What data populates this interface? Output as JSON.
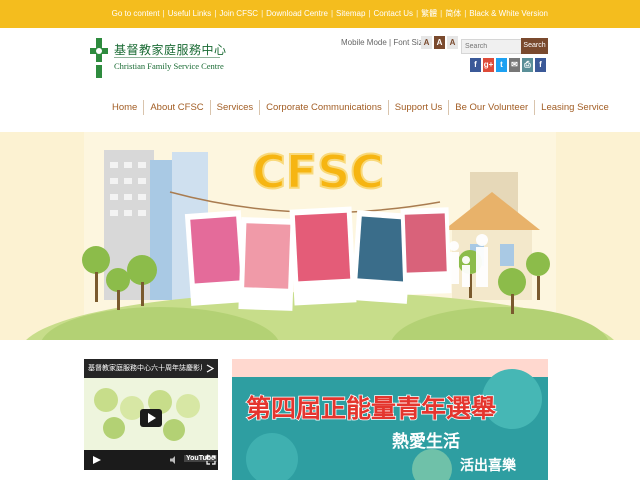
{
  "top_links": {
    "go_to_content": "Go to content",
    "useful_links": "Useful Links",
    "join": "Join CFSC",
    "download": "Download Centre",
    "sitemap": "Sitemap",
    "contact": "Contact Us",
    "trad_chinese": "繁體",
    "simp_chinese": "简体",
    "bw_version": "Black & White Version"
  },
  "logo": {
    "name_cn": "基督教家庭服務中心",
    "name_en": "Christian Family Service Centre"
  },
  "toolbar": {
    "mobile_mode": "Mobile Mode | Font Size :",
    "font_sizes": [
      "A",
      "A",
      "A"
    ],
    "search_placeholder": "Search",
    "search_button": "Search"
  },
  "social": {
    "icons": [
      "facebook-icon",
      "google-plus-icon",
      "twitter-icon",
      "email-icon",
      "print-icon",
      "facebook-icon"
    ],
    "labels": [
      "f",
      "g+",
      "t",
      "✉",
      "⎙",
      "f"
    ],
    "colors": [
      "#3b5998",
      "#dd4b39",
      "#1da1f2",
      "#777777",
      "#5a8f98",
      "#3b5998"
    ]
  },
  "nav": {
    "items": [
      "Home",
      "About CFSC",
      "Services",
      "Corporate Communications",
      "Support Us",
      "Be Our Volunteer",
      "Leasing Service"
    ]
  },
  "banner": {
    "headline": "CFSC"
  },
  "video": {
    "title": "基督教家庭服務中心六十周年誌慶影片",
    "youtube": "YouTube"
  },
  "poster": {
    "title": "第四屆正能量青年選舉",
    "sub1": "熱愛生活",
    "sub2": "活出喜樂"
  },
  "colors": {
    "topbar": "#f4bd1e",
    "nav_text": "#a25d24",
    "brand_green": "#1a6b34",
    "search_button": "#7a4a2e",
    "banner_bg": "#fcf2d2",
    "poster_bg": "#2e9ea1"
  }
}
